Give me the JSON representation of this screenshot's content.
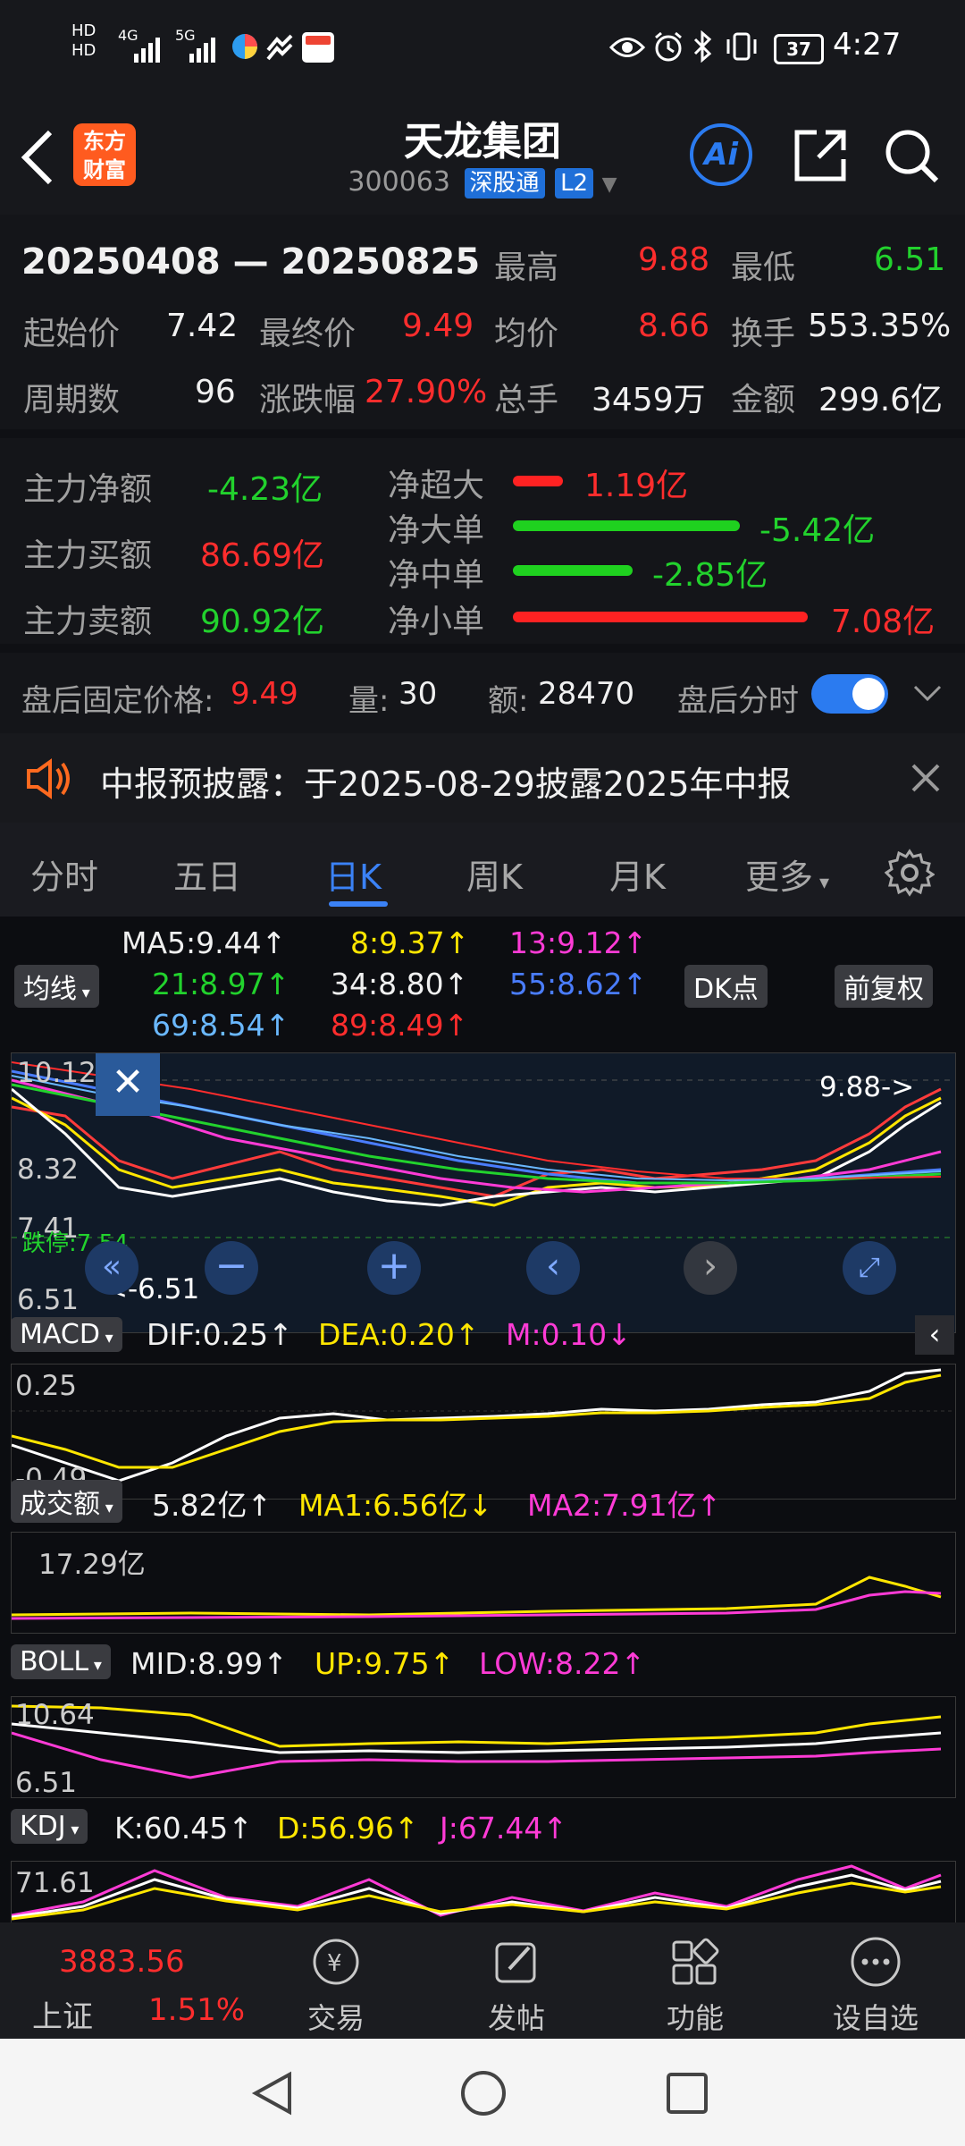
{
  "status": {
    "time": "4:27",
    "battery": "37",
    "hd1": "HD",
    "hd2": "HD",
    "net1": "4G",
    "net2": "5G"
  },
  "header": {
    "title": "天龙集团",
    "code": "300063",
    "tag1": "深股通",
    "tag2": "L2",
    "logo_line1": "东方",
    "logo_line2": "财富",
    "ai": "Ai"
  },
  "stats": {
    "range_start": "20250408",
    "range_sep": "—",
    "range_end": "20250825",
    "high_label": "最高",
    "high": "9.88",
    "low_label": "最低",
    "low": "6.51",
    "start_label": "起始价",
    "start": "7.42",
    "final_label": "最终价",
    "final": "9.49",
    "avg_label": "均价",
    "avg": "8.66",
    "turnover_label": "换手",
    "turnover": "553.35%",
    "periods_label": "周期数",
    "periods": "96",
    "change_label": "涨跌幅",
    "change": "27.90%",
    "vol_label": "总手",
    "vol": "3459万",
    "amount_label": "金额",
    "amount": "299.6亿"
  },
  "flow": {
    "net_label": "主力净额",
    "net": "-4.23亿",
    "buy_label": "主力买额",
    "buy": "86.69亿",
    "sell_label": "主力卖额",
    "sell": "90.92亿",
    "rows": [
      {
        "label": "净超大",
        "value": "1.19亿"
      },
      {
        "label": "净大单",
        "value": "-5.42亿"
      },
      {
        "label": "净中单",
        "value": "-2.85亿"
      },
      {
        "label": "净小单",
        "value": "7.08亿"
      }
    ]
  },
  "after": {
    "price_label": "盘后固定价格:",
    "price": "9.49",
    "vol_label": "量:",
    "vol": "30",
    "amt_label": "额:",
    "amt": "28470",
    "toggle_label": "盘后分时"
  },
  "notice": {
    "text": "中报预披露：于2025-08-29披露2025年中报"
  },
  "tabs": [
    "分时",
    "五日",
    "日K",
    "周K",
    "月K",
    "更多"
  ],
  "ma": {
    "selector": "均线",
    "ma5": "MA5:9.44↑",
    "ma8": "8:9.37↑",
    "ma13": "13:9.12↑",
    "ma21": "21:8.97↑",
    "ma34": "34:8.80↑",
    "ma55": "55:8.62↑",
    "ma69": "69:8.54↑",
    "ma89": "89:8.49↑",
    "dk": "DK点",
    "fq": "前复权"
  },
  "kline": {
    "y1": "10.12",
    "y2": "8.32",
    "y3": "7.41",
    "y4": "6.51",
    "hi_mark": "9.88->",
    "lo_mark": "<-6.51",
    "stop_label": "跌停",
    "stop_val": "7.54"
  },
  "macd": {
    "selector": "MACD",
    "dif": "DIF:0.25↑",
    "dea": "DEA:0.20↑",
    "m": "M:0.10↓",
    "y1": "0.25",
    "y2": "-0.49"
  },
  "volume": {
    "selector": "成交额",
    "val": "5.82亿↑",
    "ma1": "MA1:6.56亿↓",
    "ma2": "MA2:7.91亿↑",
    "y1": "17.29亿"
  },
  "boll": {
    "selector": "BOLL",
    "mid": "MID:8.99↑",
    "up": "UP:9.75↑",
    "low": "LOW:8.22↑",
    "y1": "10.64",
    "y2": "6.51"
  },
  "kdj": {
    "selector": "KDJ",
    "k": "K:60.45↑",
    "d": "D:56.96↑",
    "j": "J:67.44↑",
    "y1": "71.61"
  },
  "bottom": {
    "index_val": "3883.56",
    "index_name": "上证",
    "index_pct": "1.51%",
    "trade": "交易",
    "post": "发帖",
    "func": "功能",
    "watch": "设自选"
  },
  "colors": {
    "up": "#ff2d2d",
    "down": "#22d22d",
    "accent": "#1f6fd8",
    "ma5": "#ffffff",
    "ma8": "#ffe600",
    "ma13": "#ff3bd6"
  }
}
